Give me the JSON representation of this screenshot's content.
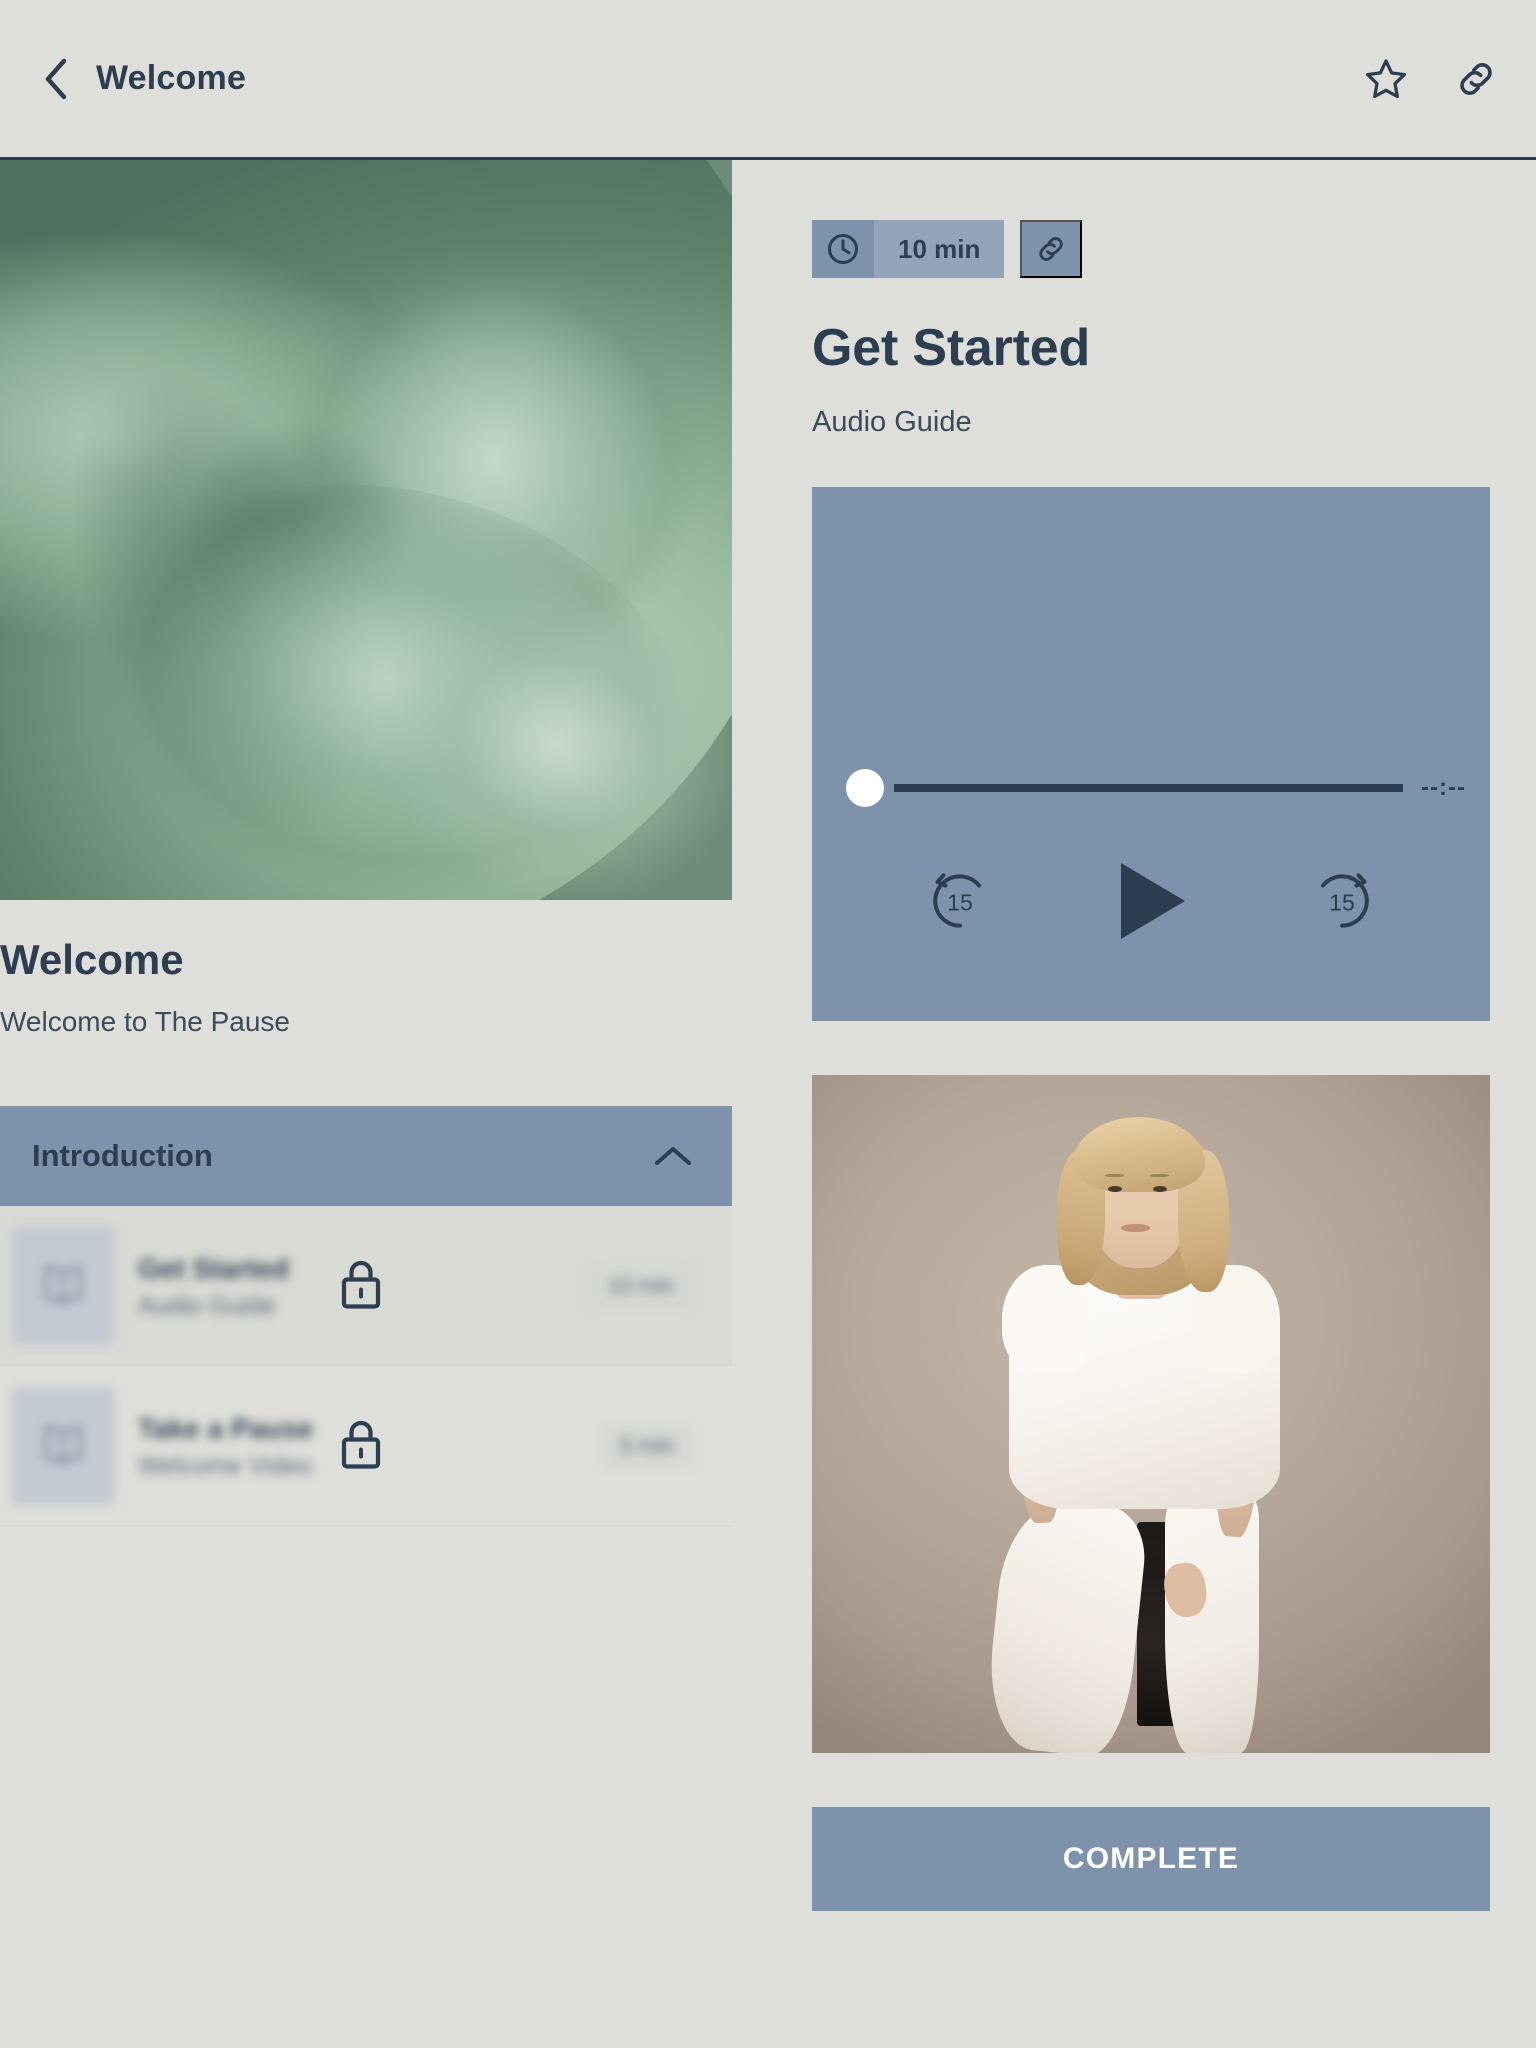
{
  "header": {
    "back_icon": "chevron-left-icon",
    "title": "Welcome",
    "favorite_icon": "star-icon",
    "share_icon": "link-icon"
  },
  "left": {
    "hero_image_alt": "abstract-green-ribbon-artwork",
    "title": "Welcome",
    "subtitle": "Welcome to The Pause",
    "accordion": {
      "label": "Introduction",
      "expanded": true,
      "chevron_icon": "chevron-up-icon",
      "lessons": [
        {
          "thumb_icon": "open-book-icon",
          "name": "Get Started",
          "subtitle": "Audio Guide",
          "duration": "10 min",
          "locked": true,
          "lock_icon": "lock-icon",
          "active": true
        },
        {
          "thumb_icon": "open-book-icon",
          "name": "Take a Pause",
          "subtitle": "Welcome Video",
          "duration": "5 min",
          "locked": true,
          "lock_icon": "lock-icon",
          "active": false
        }
      ]
    }
  },
  "right": {
    "duration_badge": {
      "icon": "clock-icon",
      "text": "10 min"
    },
    "share_badge_icon": "link-icon",
    "title": "Get Started",
    "subtitle": "Audio Guide",
    "player": {
      "progress_percent": 0,
      "time_display": "--:--",
      "rewind_label": "15",
      "rewind_icon": "rewind-15-icon",
      "play_icon": "play-icon",
      "forward_label": "15",
      "forward_icon": "forward-15-icon"
    },
    "photo_alt": "instructor-portrait-seated-white-outfit",
    "complete_label": "COMPLETE"
  },
  "colors": {
    "page_background": "#dedfda",
    "ink": "#2d3e50",
    "accent_slate": "#7e92ab",
    "accent_slate_light": "#93a4b9",
    "hero_green": "#7da188",
    "photo_backdrop": "#b6a89a"
  }
}
